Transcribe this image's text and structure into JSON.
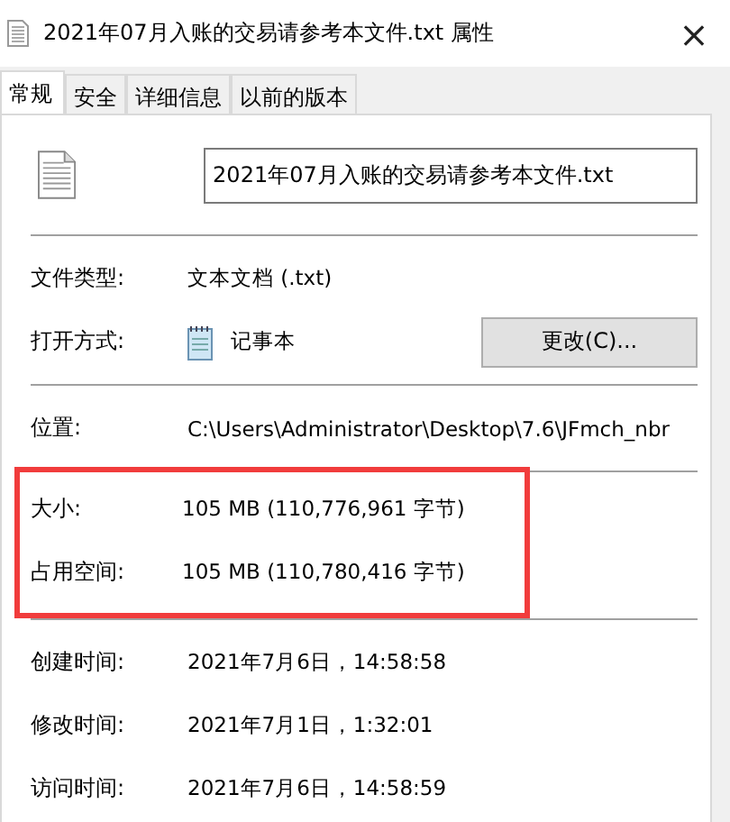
{
  "window": {
    "title": "2021年07月入账的交易请参考本文件.txt 属性",
    "close": "×"
  },
  "tabs": [
    {
      "label": "常规",
      "selected": true
    },
    {
      "label": "安全",
      "selected": false
    },
    {
      "label": "详细信息",
      "selected": false
    },
    {
      "label": "以前的版本",
      "selected": false
    }
  ],
  "file_name": {
    "value": "2021年07月入账的交易请参考本文件.txt"
  },
  "sections": [
    {
      "highlighted": false,
      "rows": [
        {
          "label": "文件类型:",
          "value": "文本文档 (.txt)"
        },
        {
          "label": "打开方式:",
          "value": "记事本",
          "kind": "app",
          "button": "更改(C)..."
        }
      ]
    },
    {
      "highlighted": false,
      "rows": [
        {
          "label": "位置:",
          "value": "C:\\Users\\Administrator\\Desktop\\7.6\\JFmch_nbr"
        }
      ]
    },
    {
      "highlighted": true,
      "rows": [
        {
          "label": "大小:",
          "value": "105 MB (110,776,961 字节)"
        },
        {
          "label": "占用空间:",
          "value": "105 MB (110,780,416 字节)"
        }
      ]
    },
    {
      "highlighted": false,
      "rows": [
        {
          "label": "创建时间:",
          "value": "2021年7月6日，14:58:58"
        },
        {
          "label": "修改时间:",
          "value": "2021年7月1日，1:32:01"
        },
        {
          "label": "访问时间:",
          "value": "2021年7月6日，14:58:59"
        }
      ]
    }
  ]
}
